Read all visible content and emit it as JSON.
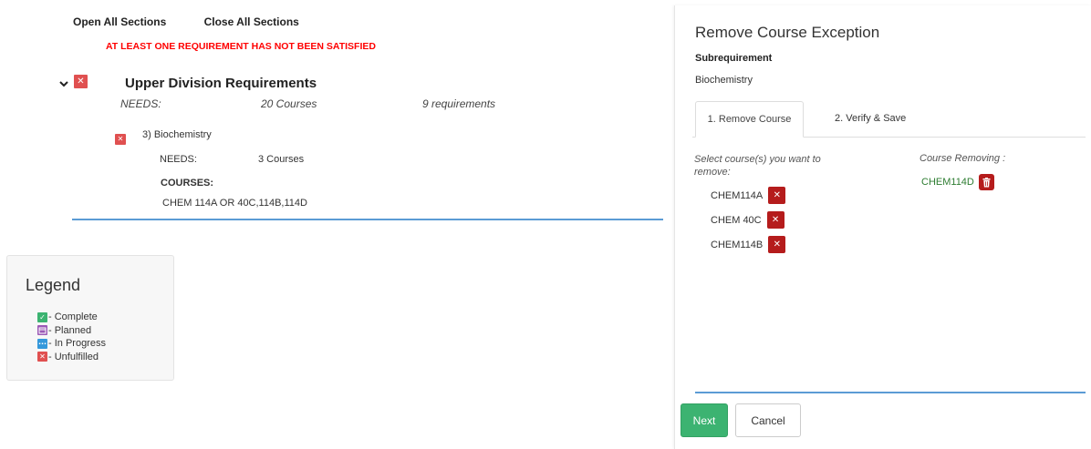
{
  "audit": {
    "open_all": "Open All Sections",
    "close_all": "Close All Sections",
    "warning": "AT LEAST ONE REQUIREMENT HAS NOT BEEN SATISFIED",
    "requirement": {
      "title": "Upper Division Requirements",
      "needs_label": "NEEDS:",
      "needs_count": "20  Courses",
      "needs_reqs": "9  requirements"
    },
    "subrequirement": {
      "title": "3) Biochemistry",
      "needs_label": "NEEDS:",
      "needs_count": "3  Courses",
      "courses_label": "COURSES:",
      "courses_list": "CHEM 114A OR 40C,114B,114D"
    }
  },
  "legend": {
    "title": "Legend",
    "items": [
      {
        "label": "- Complete",
        "icon": "check-icon",
        "color": "#3cb371"
      },
      {
        "label": "- Planned",
        "icon": "calendar-icon",
        "color": "#9b59b6"
      },
      {
        "label": "- In Progress",
        "icon": "ellipsis-icon",
        "color": "#3498db"
      },
      {
        "label": "- Unfulfilled",
        "icon": "x-icon",
        "color": "#e05050"
      }
    ]
  },
  "panel": {
    "title": "Remove Course Exception",
    "subrequirement_label": "Subrequirement",
    "subrequirement_value": "Biochemistry",
    "tabs": [
      {
        "label": "1. Remove Course",
        "active": true
      },
      {
        "label": "2. Verify & Save",
        "active": false
      }
    ],
    "select_label": "Select course(s) you want to remove:",
    "courses": [
      "CHEM114A",
      "CHEM 40C",
      "CHEM114B"
    ],
    "removing_label": "Course Removing :",
    "removing": [
      "CHEM114D"
    ],
    "next_label": "Next",
    "cancel_label": "Cancel"
  },
  "colors": {
    "accent_blue": "#5b9bd5",
    "warning_red": "#ff0000",
    "remove_red": "#b51c1c",
    "next_green": "#3cb371"
  }
}
